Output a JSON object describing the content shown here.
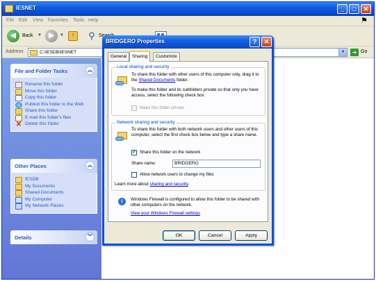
{
  "explorer": {
    "title": "IESNET",
    "menu": [
      "File",
      "Edit",
      "View",
      "Favorites",
      "Tools",
      "Help"
    ],
    "toolbar": {
      "back_label": "Back",
      "search_label": "Search",
      "folders_label": "Folders"
    },
    "address": {
      "label": "Address",
      "value": "C:\\IESDB\\IESNET",
      "go_label": "Go"
    }
  },
  "taskpane": {
    "file_folder_tasks": {
      "title": "File and Folder Tasks",
      "items": [
        "Rename this folder",
        "Move this folder",
        "Copy this folder",
        "Publish this folder to the Web",
        "Share this folder",
        "E-mail this folder's files",
        "Delete this folder"
      ]
    },
    "other_places": {
      "title": "Other Places",
      "items": [
        "IESDB",
        "My Documents",
        "Shared Documents",
        "My Computer",
        "My Network Places"
      ]
    },
    "details": {
      "title": "Details"
    }
  },
  "dialog": {
    "title": "BRIDGERO Properties",
    "help_glyph": "?",
    "close_glyph": "✕",
    "tabs": [
      "General",
      "Sharing",
      "Customize"
    ],
    "active_tab": "Sharing",
    "local": {
      "title": "Local sharing and security",
      "text1_before": "To share this folder with other users of this computer only, drag it to the ",
      "text1_link": "Shared Documents",
      "text1_after": " folder.",
      "text2": "To make this folder and its subfolders private so that only you have access, select the following check box.",
      "private_checkbox": {
        "label": "Make this folder private",
        "checked": false,
        "enabled": false
      }
    },
    "network": {
      "title": "Network sharing and security",
      "text": "To share this folder with both network users and other users of this computer, select the first check box below and type a share name.",
      "share_checkbox": {
        "label": "Share this folder on the network",
        "checked": true
      },
      "share_name_label": "Share name:",
      "share_name_value": "BRIDGERO",
      "allow_change_checkbox": {
        "label": "Allow network users to change my files",
        "checked": false
      },
      "learn_more_prefix": "Learn more about ",
      "learn_more_link": "sharing and security",
      "learn_more_suffix": "."
    },
    "firewall": {
      "text": "Windows Firewall is configured to allow this folder to be shared with other computers on the network.",
      "link": "View your Windows Firewall settings"
    },
    "buttons": {
      "ok": "OK",
      "cancel": "Cancel",
      "apply": "Apply"
    }
  },
  "colors": {
    "xp_blue": "#0a4fd6",
    "task_link": "#215dc6",
    "group_title": "#0046d5",
    "check_green": "#21a121"
  }
}
